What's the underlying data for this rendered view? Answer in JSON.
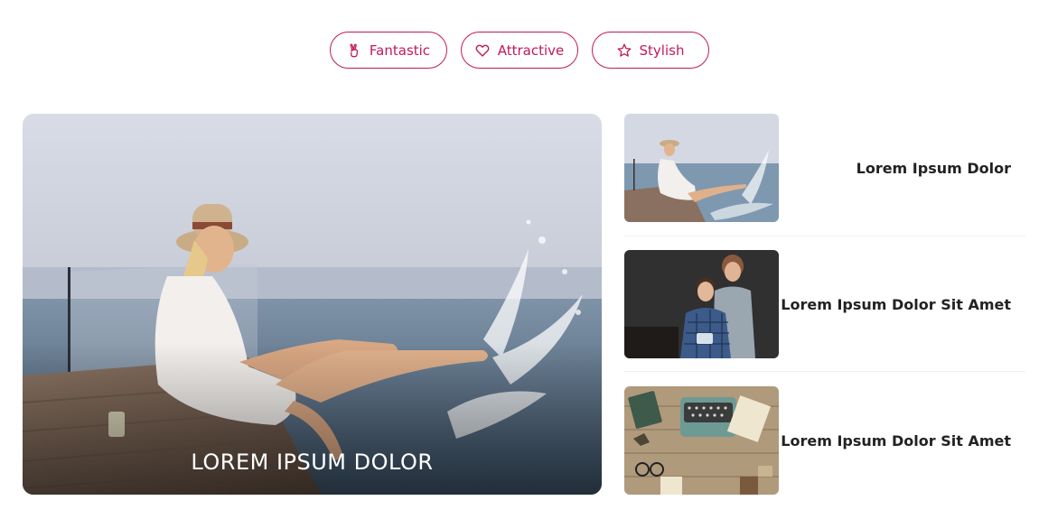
{
  "tabs": [
    {
      "label": "Fantastic",
      "icon": "peace-hand-icon"
    },
    {
      "label": "Attractive",
      "icon": "heart-icon"
    },
    {
      "label": "Stylish",
      "icon": "star-icon"
    }
  ],
  "accent_color": "#c2185b",
  "featured": {
    "caption": "LOREM IPSUM DOLOR",
    "image": "woman-splashing-pool-photo"
  },
  "side_posts": [
    {
      "title": "Lorem Ipsum Dolor",
      "image": "woman-splashing-pool-thumbnail"
    },
    {
      "title": "Lorem Ipsum Dolor Sit Amet",
      "image": "couple-photo-thumbnail"
    },
    {
      "title": "Lorem Ipsum Dolor Sit Amet",
      "image": "typewriter-desk-thumbnail"
    }
  ]
}
